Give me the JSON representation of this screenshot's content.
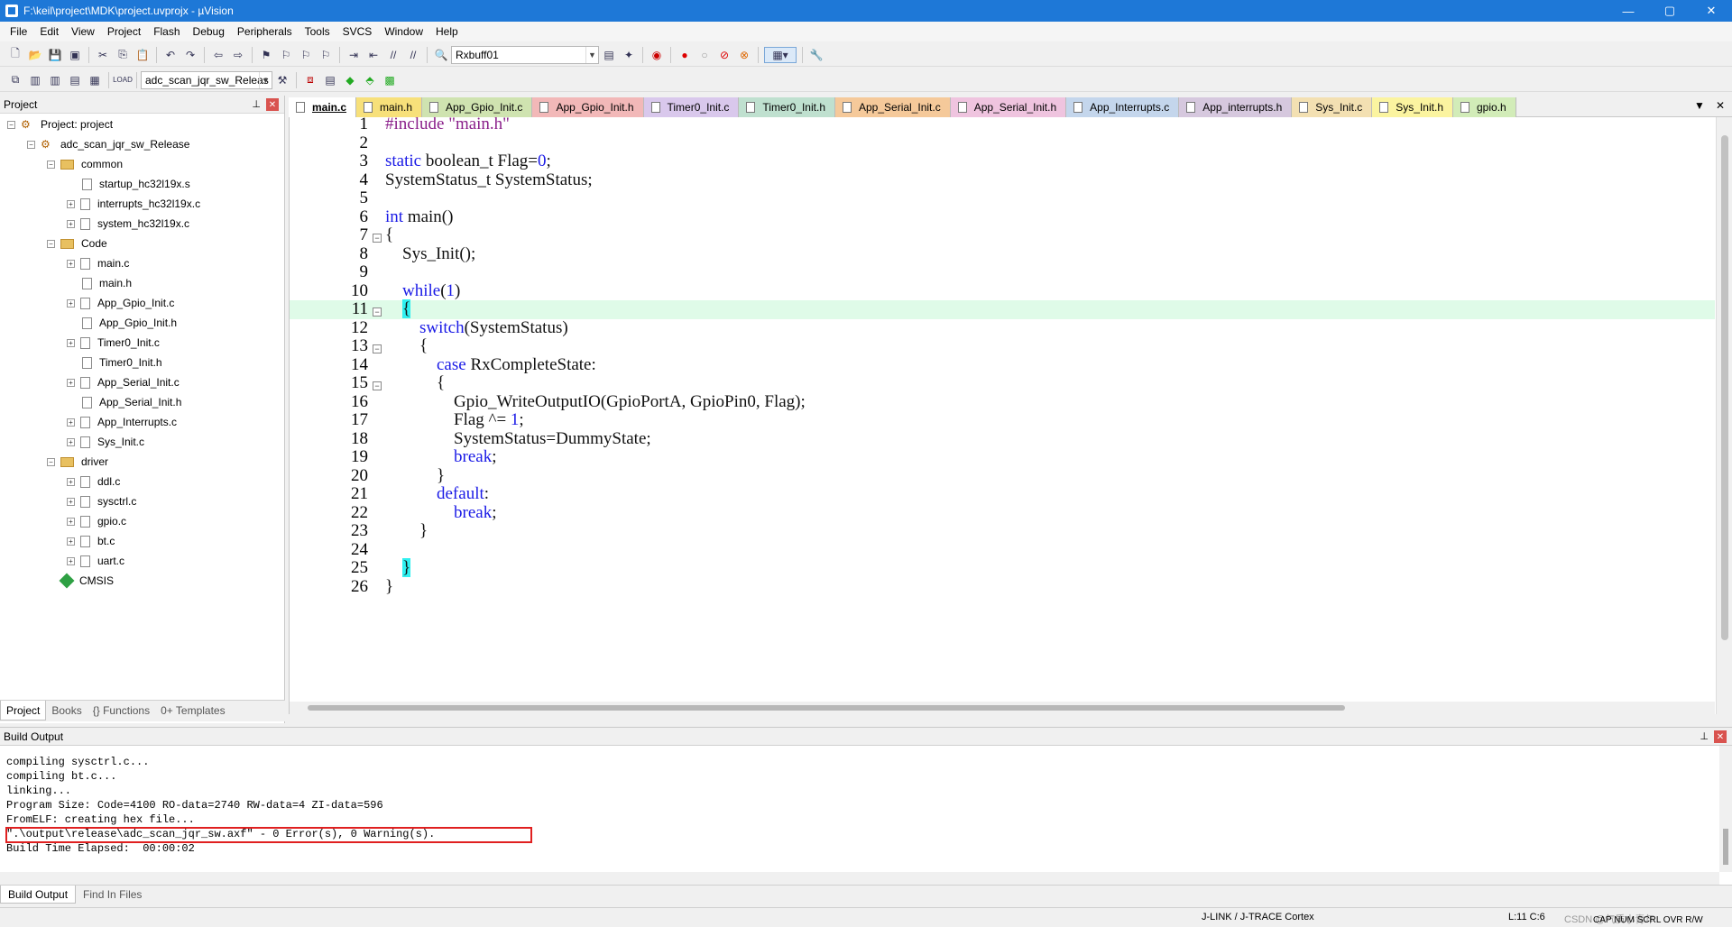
{
  "window": {
    "title": "F:\\keil\\project\\MDK\\project.uvprojx - µVision",
    "min": "—",
    "max": "▢",
    "close": "✕"
  },
  "menu": [
    "File",
    "Edit",
    "View",
    "Project",
    "Flash",
    "Debug",
    "Peripherals",
    "Tools",
    "SVCS",
    "Window",
    "Help"
  ],
  "toolbar": {
    "find_combo": "Rxbuff01",
    "target_combo": "adc_scan_jqr_sw_Releas"
  },
  "project_panel": {
    "title": "Project",
    "tree": [
      {
        "label": "Project: project"
      },
      {
        "label": "adc_scan_jqr_sw_Release"
      },
      {
        "label": "common"
      },
      {
        "label": "startup_hc32l19x.s"
      },
      {
        "label": "interrupts_hc32l19x.c"
      },
      {
        "label": "system_hc32l19x.c"
      },
      {
        "label": "Code"
      },
      {
        "label": "main.c"
      },
      {
        "label": "main.h"
      },
      {
        "label": "App_Gpio_Init.c"
      },
      {
        "label": "App_Gpio_Init.h"
      },
      {
        "label": "Timer0_Init.c"
      },
      {
        "label": "Timer0_Init.h"
      },
      {
        "label": "App_Serial_Init.c"
      },
      {
        "label": "App_Serial_Init.h"
      },
      {
        "label": "App_Interrupts.c"
      },
      {
        "label": "Sys_Init.c"
      },
      {
        "label": "driver"
      },
      {
        "label": "ddl.c"
      },
      {
        "label": "sysctrl.c"
      },
      {
        "label": "gpio.c"
      },
      {
        "label": "bt.c"
      },
      {
        "label": "uart.c"
      },
      {
        "label": "CMSIS"
      }
    ],
    "tabs": [
      "Project",
      "Books",
      "{} Functions",
      "0+ Templates"
    ]
  },
  "editor": {
    "tabs": [
      {
        "label": "main.c",
        "color": "#ffffff"
      },
      {
        "label": "main.h",
        "color": "#f7e07a"
      },
      {
        "label": "App_Gpio_Init.c",
        "color": "#cfe3b0"
      },
      {
        "label": "App_Gpio_Init.h",
        "color": "#f2b8b8"
      },
      {
        "label": "Timer0_Init.c",
        "color": "#d9c8ec"
      },
      {
        "label": "Timer0_Init.h",
        "color": "#bfe0cf"
      },
      {
        "label": "App_Serial_Init.c",
        "color": "#f5c99a"
      },
      {
        "label": "App_Serial_Init.h",
        "color": "#efc4df"
      },
      {
        "label": "App_Interrupts.c",
        "color": "#c4d6ec"
      },
      {
        "label": "App_interrupts.h",
        "color": "#d6c8de"
      },
      {
        "label": "Sys_Init.c",
        "color": "#f3e0b2"
      },
      {
        "label": "Sys_Init.h",
        "color": "#fbf4a0"
      },
      {
        "label": "gpio.h",
        "color": "#d2ecb8"
      }
    ],
    "lines": [
      {
        "n": "1",
        "text": "#include \"main.h\""
      },
      {
        "n": "2",
        "text": ""
      },
      {
        "n": "3",
        "text": "static boolean_t Flag=0;"
      },
      {
        "n": "4",
        "text": "SystemStatus_t SystemStatus;"
      },
      {
        "n": "5",
        "text": ""
      },
      {
        "n": "6",
        "text": "int main()"
      },
      {
        "n": "7",
        "text": "{"
      },
      {
        "n": "8",
        "text": "    Sys_Init();"
      },
      {
        "n": "9",
        "text": ""
      },
      {
        "n": "10",
        "text": "    while(1)"
      },
      {
        "n": "11",
        "text": "    {"
      },
      {
        "n": "12",
        "text": "        switch(SystemStatus)"
      },
      {
        "n": "13",
        "text": "        {"
      },
      {
        "n": "14",
        "text": "            case RxCompleteState:"
      },
      {
        "n": "15",
        "text": "            {"
      },
      {
        "n": "16",
        "text": "                Gpio_WriteOutputIO(GpioPortA, GpioPin0, Flag);"
      },
      {
        "n": "17",
        "text": "                Flag ^= 1;"
      },
      {
        "n": "18",
        "text": "                SystemStatus=DummyState;"
      },
      {
        "n": "19",
        "text": "                break;"
      },
      {
        "n": "20",
        "text": "            }"
      },
      {
        "n": "21",
        "text": "            default:"
      },
      {
        "n": "22",
        "text": "                break;"
      },
      {
        "n": "23",
        "text": "        }"
      },
      {
        "n": "24",
        "text": ""
      },
      {
        "n": "25",
        "text": "    }"
      },
      {
        "n": "26",
        "text": "}"
      }
    ]
  },
  "build_output": {
    "title": "Build Output",
    "lines": [
      "compiling sysctrl.c...",
      "compiling bt.c...",
      "linking...",
      "Program Size: Code=4100 RO-data=2740 RW-data=4 ZI-data=596",
      "FromELF: creating hex file...",
      "\".\\output\\release\\adc_scan_jqr_sw.axf\" - 0 Error(s), 0 Warning(s).",
      "Build Time Elapsed:  00:00:02"
    ],
    "tabs": [
      "Build Output",
      "Find In Files"
    ]
  },
  "status": {
    "debugger": "J-LINK / J-TRACE Cortex",
    "position": "L:11 C:6",
    "watermark": "CSDN @气质小青年",
    "flags": "CAP  NUM  SCRL  OVR  R/W"
  }
}
